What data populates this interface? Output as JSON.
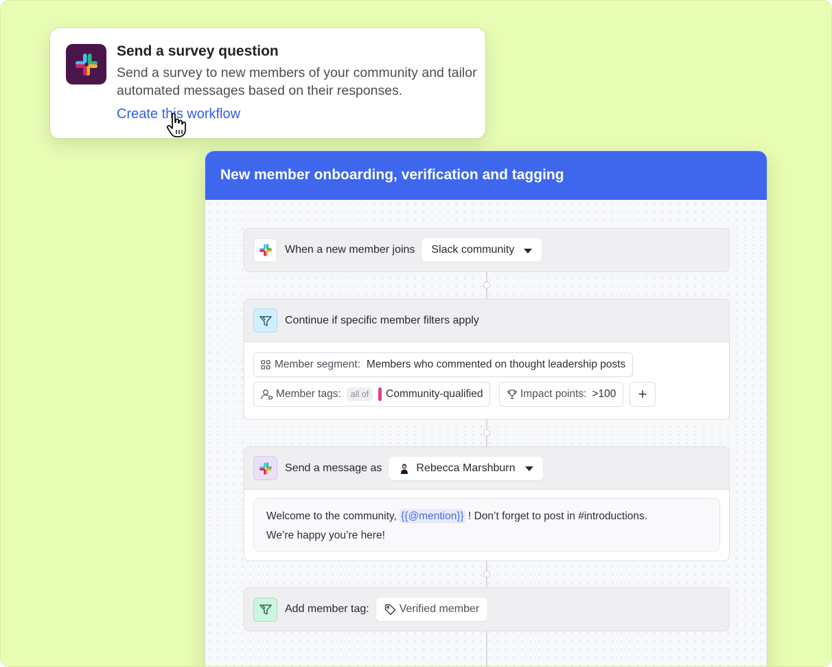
{
  "survey_card": {
    "title": "Send a survey question",
    "description": "Send a survey to new members of your community and tailor automated messages based on their responses.",
    "link": "Create this workflow"
  },
  "workflow": {
    "title": "New member onboarding, verification and tagging",
    "trigger": {
      "label": "When a new member joins",
      "source": "Slack community"
    },
    "filter": {
      "label": "Continue if specific member filters apply",
      "segment_label": "Member segment:",
      "segment_value": "Members who commented on thought leadership posts",
      "tags_label": "Member tags:",
      "tags_mode": "all of",
      "tags_value": "Community-qualified",
      "impact_label": "Impact points:",
      "impact_value": ">100",
      "add_label": "+"
    },
    "message": {
      "label": "Send a message as",
      "sender": "Rebecca Marshburn",
      "text_before": "Welcome to the community, ",
      "mention": "{{@mention}}",
      "text_after": " ! Don’t forget to post in #introductions.",
      "text_line2": "We’re happy you’re here!"
    },
    "tag_step": {
      "label": "Add member tag:",
      "tag": "Verified member"
    }
  },
  "colors": {
    "background": "#e8fdb4",
    "header": "#3e67ee",
    "link": "#2f5fe6",
    "slack": "#4a154b",
    "tag_accent": "#e0428a"
  },
  "icons": [
    "slack-logo-icon",
    "hand-cursor-icon",
    "filter-icon",
    "segment-grid-icon",
    "member-tag-icon",
    "trophy-icon",
    "avatar-icon",
    "tag-icon",
    "caret-down-icon"
  ]
}
